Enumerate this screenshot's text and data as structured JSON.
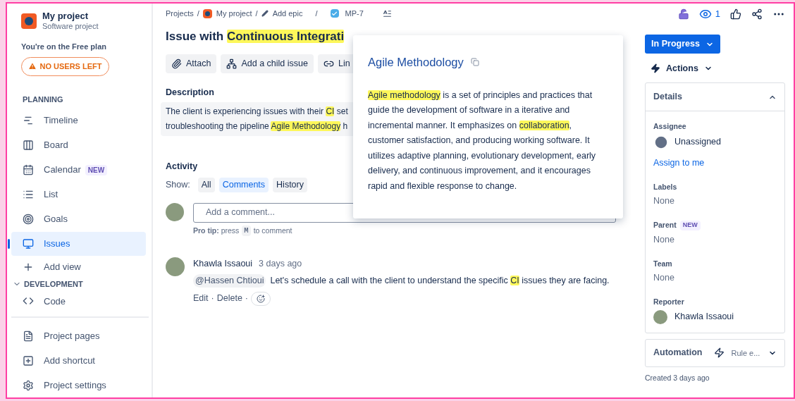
{
  "project": {
    "name": "My project",
    "type": "Software project",
    "plan_note": "You're on the Free plan",
    "users_badge": "NO USERS LEFT"
  },
  "sidebar": {
    "planning_label": "PLANNING",
    "items": [
      {
        "label": "Timeline",
        "selected": false
      },
      {
        "label": "Board",
        "selected": false
      },
      {
        "label": "Calendar",
        "badge": "NEW",
        "selected": false
      },
      {
        "label": "List",
        "selected": false
      },
      {
        "label": "Goals",
        "selected": false
      },
      {
        "label": "Issues",
        "selected": true
      }
    ],
    "add_view": "Add view",
    "development": {
      "label": "DEVELOPMENT",
      "expanded": true,
      "items": [
        {
          "label": "Code"
        }
      ]
    },
    "footer_items": [
      {
        "label": "Project pages"
      },
      {
        "label": "Add shortcut"
      },
      {
        "label": "Project settings"
      }
    ]
  },
  "breadcrumbs": {
    "separator": "/",
    "items": [
      "Projects",
      "My project",
      "Add epic",
      "MP-7"
    ]
  },
  "top_actions": {
    "watchers": "1"
  },
  "issue": {
    "title": [
      {
        "text": "Issue with ",
        "highlight": false
      },
      {
        "text": "Continuous Integrati",
        "highlight": true
      }
    ],
    "buttons": [
      "Attach",
      "Add a child issue",
      "Lin"
    ],
    "description_label": "Description",
    "description_lines": [
      [
        {
          "text": "The client is experiencing issues with their ",
          "highlight": false
        },
        {
          "text": "CI",
          "highlight": true
        },
        {
          "text": " set",
          "highlight": false
        }
      ],
      [
        {
          "text": "troubleshooting the pipeline ",
          "highlight": false
        },
        {
          "text": "Agile Methodology",
          "highlight": true
        },
        {
          "text": " h",
          "highlight": false
        }
      ]
    ]
  },
  "activity": {
    "title": "Activity",
    "show_label": "Show:",
    "filters": [
      {
        "label": "All",
        "selected": false
      },
      {
        "label": "Comments",
        "selected": true
      },
      {
        "label": "History",
        "selected": false
      }
    ],
    "comment_placeholder": "Add a comment...",
    "tip": "**Pro tip:** press",
    "tip_key": "M",
    "tip_suffix": "to comment",
    "comments": [
      {
        "author": "Khawla Issaoui",
        "time": "3 days ago",
        "mention": "@Hassen Chtioui",
        "body": [
          {
            "text": "Let's schedule a call with the client to understand the specific ",
            "highlight": false
          },
          {
            "text": "CI",
            "highlight": true
          },
          {
            "text": " issues they are facing.",
            "highlight": false
          }
        ],
        "actions": [
          "Edit",
          "Delete"
        ],
        "separator": "·"
      }
    ]
  },
  "popover": {
    "title": "Agile Methodology",
    "body": [
      {
        "text": "Agile methodology",
        "highlight": true
      },
      {
        "text": " is a set of principles and practices that guide the development of software in a iterative and incremental manner. It emphasizes on ",
        "highlight": false
      },
      {
        "text": "collaboration",
        "highlight": true
      },
      {
        "text": ", customer satisfaction, and producing working software. It utilizes adaptive planning, evolutionary development, early delivery, and continuous improvement, and it encourages rapid and flexible response to change.",
        "highlight": false
      }
    ]
  },
  "status_button": "In Progress",
  "actions_button": "Actions",
  "details": {
    "title": "Details",
    "expanded": true,
    "fields": [
      {
        "kind": "person",
        "label": "Assignee",
        "value": "Unassigned",
        "link": "Assign to me"
      },
      {
        "kind": "text",
        "label": "Labels",
        "value": "None"
      },
      {
        "kind": "text",
        "label": "Parent",
        "badge": "NEW",
        "value": "None"
      },
      {
        "kind": "text",
        "label": "Team",
        "value": "None"
      },
      {
        "kind": "avatar",
        "label": "Reporter",
        "value": "Khawla Issaoui"
      }
    ]
  },
  "automation": {
    "title": "Automation",
    "value": "Rule e..."
  },
  "created": "Created 3 days ago"
}
